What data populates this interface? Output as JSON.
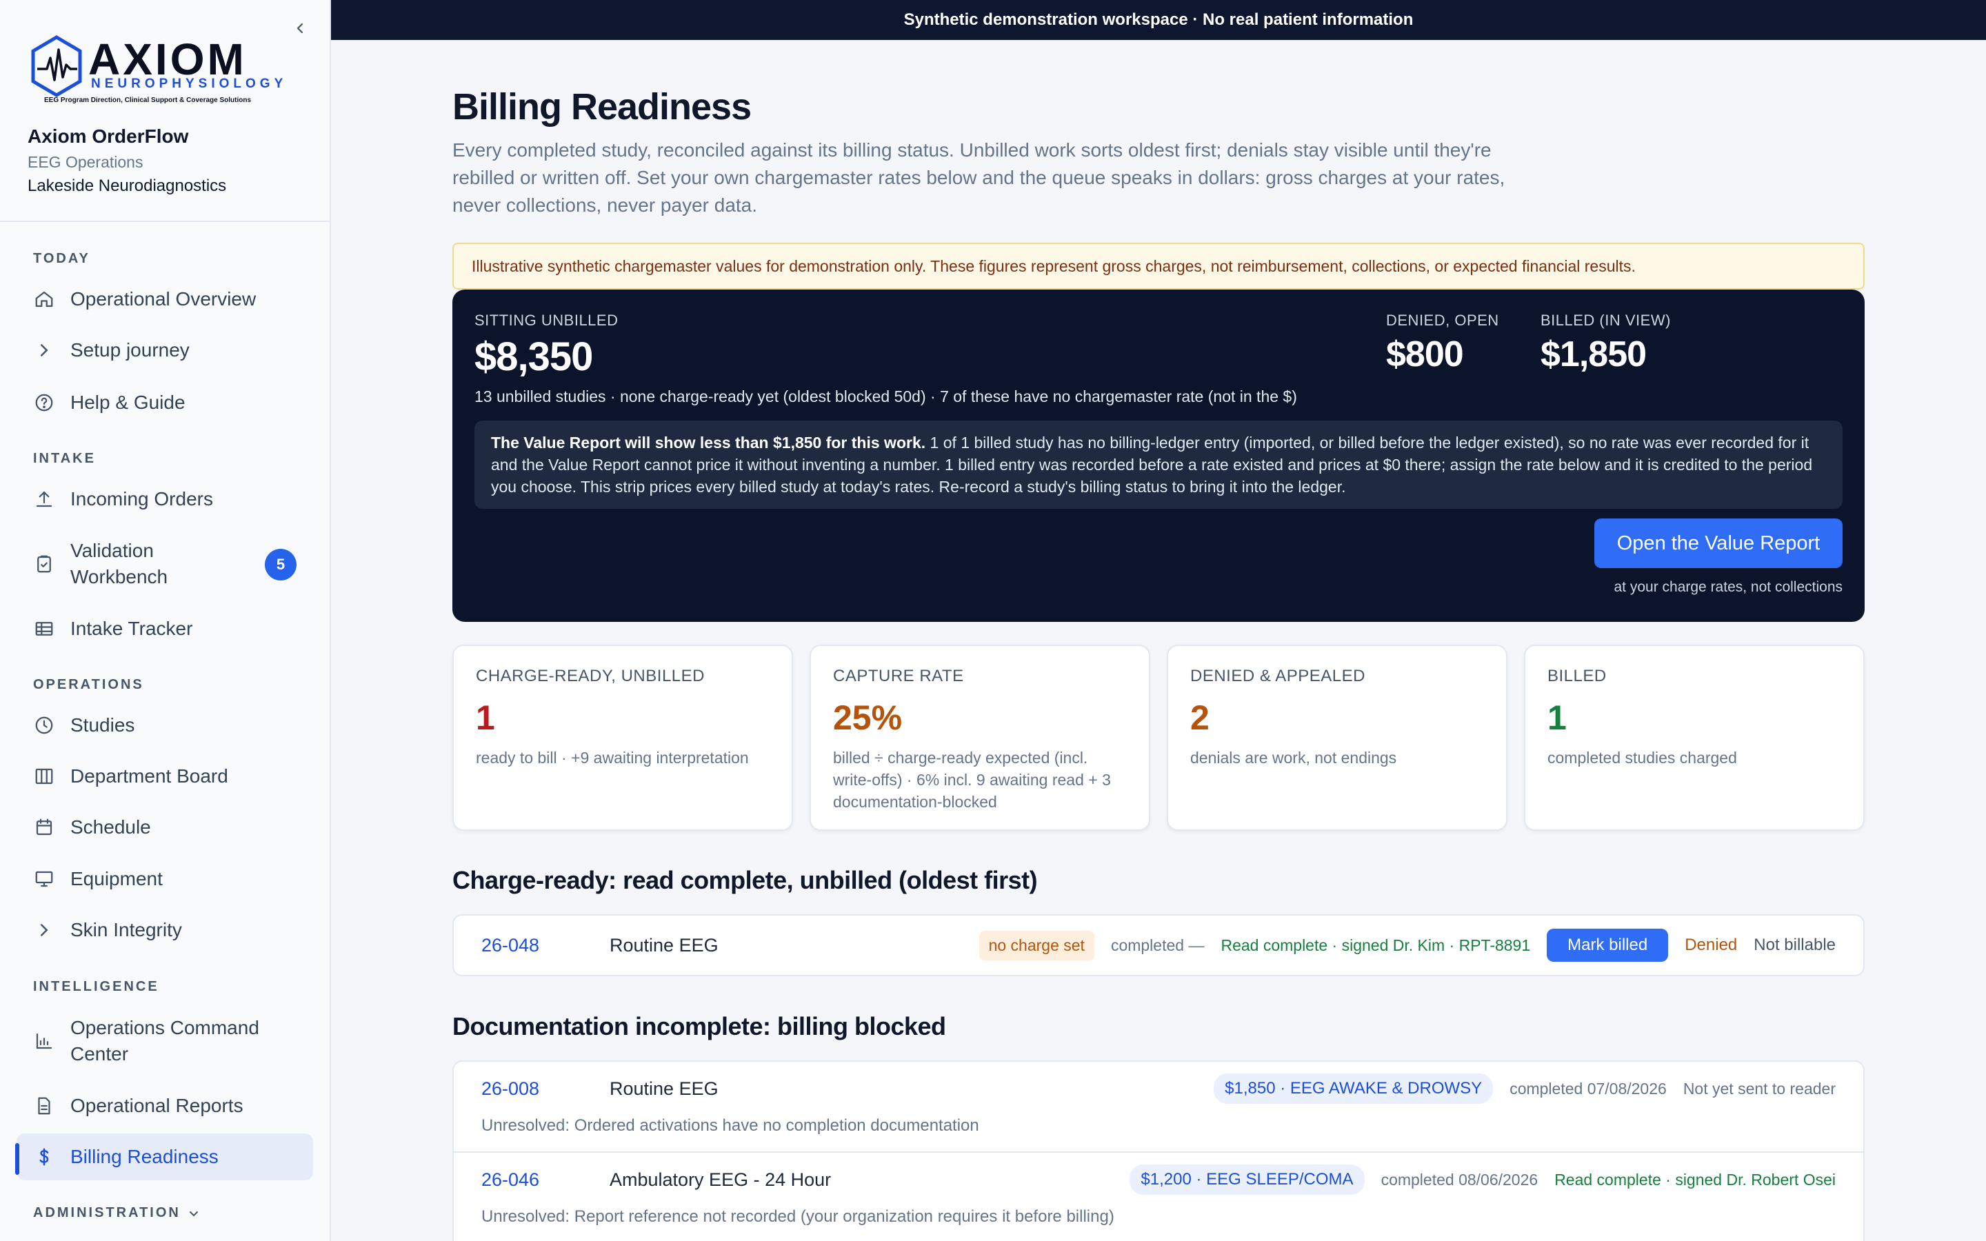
{
  "banner": "Synthetic demonstration workspace · No real patient information",
  "logo": {
    "word": "AXIOM",
    "sub": "NEUROPHYSIOLOGY",
    "tagline": "EEG Program Direction, Clinical Support & Coverage Solutions"
  },
  "org": {
    "name": "Axiom OrderFlow",
    "dept": "EEG Operations",
    "site": "Lakeside Neurodiagnostics"
  },
  "nav": {
    "today": "TODAY",
    "operational_overview": "Operational Overview",
    "setup_journey": "Setup journey",
    "help_guide": "Help & Guide",
    "intake": "INTAKE",
    "incoming_orders": "Incoming Orders",
    "validation_workbench": "Validation Workbench",
    "validation_badge": "5",
    "intake_tracker": "Intake Tracker",
    "operations": "OPERATIONS",
    "studies": "Studies",
    "department_board": "Department Board",
    "schedule": "Schedule",
    "equipment": "Equipment",
    "skin_integrity": "Skin Integrity",
    "intelligence": "INTELLIGENCE",
    "ops_command_center": "Operations Command Center",
    "operational_reports": "Operational Reports",
    "billing_readiness": "Billing Readiness",
    "administration": "ADMINISTRATION"
  },
  "page": {
    "title": "Billing Readiness",
    "description": "Every completed study, reconciled against its billing status. Unbilled work sorts oldest first; denials stay visible until they're rebilled or written off. Set your own chargemaster rates below and the queue speaks in dollars: gross charges at your rates, never collections, never payer data.",
    "warning": "Illustrative synthetic chargemaster values for demonstration only. These figures represent gross charges, not reimbursement, collections, or expected financial results."
  },
  "summary": {
    "unbilled_label": "SITTING UNBILLED",
    "unbilled_value": "$8,350",
    "denied_label": "DENIED, OPEN",
    "denied_value": "$800",
    "billed_label": "BILLED (IN VIEW)",
    "billed_value": "$1,850",
    "subtext": "13 unbilled studies · none charge-ready yet (oldest blocked 50d) · 7 of these have no chargemaster rate (not in the $)",
    "note_bold": "The Value Report will show less than $1,850 for this work.",
    "note_text": " 1 of 1 billed study has no billing-ledger entry (imported, or billed before the ledger existed), so no rate was ever recorded for it and the Value Report cannot price it without inventing a number. 1 billed entry was recorded before a rate existed and prices at $0 there; assign the rate below and it is credited to the period you choose. This strip prices every billed study at today's rates. Re-record a study's billing status to bring it into the ledger.",
    "button": "Open the Value Report",
    "button_caption": "at your charge rates, not collections"
  },
  "kpis": [
    {
      "label": "CHARGE-READY, UNBILLED",
      "value": "1",
      "desc": "ready to bill · +9 awaiting interpretation",
      "color": "#b91c1c"
    },
    {
      "label": "CAPTURE RATE",
      "value": "25%",
      "desc": "billed ÷ charge-ready expected (incl. write-offs) · 6% incl. 9 awaiting read + 3 documentation-blocked",
      "color": "#b45309"
    },
    {
      "label": "DENIED & APPEALED",
      "value": "2",
      "desc": "denials are work, not endings",
      "color": "#b45309"
    },
    {
      "label": "BILLED",
      "value": "1",
      "desc": "completed studies charged",
      "color": "#15803d"
    }
  ],
  "charge_ready": {
    "title": "Charge-ready: read complete, unbilled (oldest first)",
    "rows": [
      {
        "id": "26-048",
        "type": "Routine EEG",
        "charge": "no charge set",
        "completed": "completed —",
        "read": "Read complete · signed Dr. Kim · RPT-8891",
        "mark": "Mark billed",
        "denied": "Denied",
        "not_billable": "Not billable"
      }
    ]
  },
  "doc_incomplete": {
    "title": "Documentation incomplete: billing blocked",
    "rows": [
      {
        "id": "26-008",
        "type": "Routine EEG",
        "charge": "$1,850 · EEG AWAKE & DROWSY",
        "completed": "completed 07/08/2026",
        "status": "Not yet sent to reader",
        "unresolved": "Unresolved: Ordered activations have no completion documentation"
      },
      {
        "id": "26-046",
        "type": "Ambulatory EEG - 24 Hour",
        "charge": "$1,200 · EEG SLEEP/COMA",
        "completed": "completed 08/06/2026",
        "status": "Read complete · signed Dr. Robert Osei",
        "unresolved": "Unresolved: Report reference not recorded (your organization requires it before billing)"
      }
    ]
  },
  "colors": {
    "accent": "#2f6df6",
    "banner": "#0f1630",
    "dark_panel": "#0c142b"
  },
  "icons": [
    "home-icon",
    "chevron-right-icon",
    "help-circle-icon",
    "upload-icon",
    "clipboard-check-icon",
    "table-icon",
    "clock-icon",
    "columns-icon",
    "calendar-icon",
    "monitor-icon",
    "bar-chart-icon",
    "file-text-icon",
    "dollar-icon",
    "chevron-left-icon",
    "chevron-down-icon"
  ]
}
